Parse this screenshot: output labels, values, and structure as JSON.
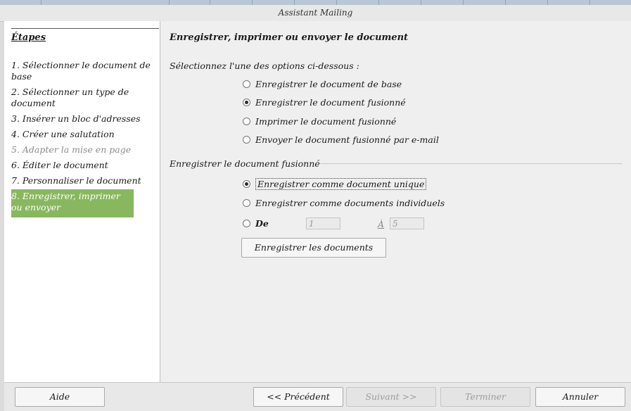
{
  "window": {
    "title": "Assistant Mailing"
  },
  "sidebar": {
    "title": "Étapes",
    "steps": [
      {
        "label": "1. Sélectionner le document de base",
        "state": "normal"
      },
      {
        "label": "2. Sélectionner un type de document",
        "state": "normal"
      },
      {
        "label": "3. Insérer un bloc d'adresses",
        "state": "normal"
      },
      {
        "label": "4. Créer une salutation",
        "state": "normal"
      },
      {
        "label": "5. Adapter la mise en page",
        "state": "disabled"
      },
      {
        "label": "6. Éditer le document",
        "state": "normal"
      },
      {
        "label": "7. Personnaliser le document",
        "state": "normal"
      },
      {
        "label": "8. Enregistrer, imprimer ou envoyer",
        "state": "active"
      }
    ]
  },
  "main": {
    "title": "Enregistrer, imprimer ou envoyer le document",
    "instruction": "Sélectionnez l'une des options ci-dessous :",
    "options": [
      {
        "label": "Enregistrer le document de base",
        "checked": false
      },
      {
        "label": "Enregistrer le document fusionné",
        "checked": true
      },
      {
        "label": "Imprimer le document fusionné",
        "checked": false
      },
      {
        "label": "Envoyer le document fusionné par e-mail",
        "checked": false
      }
    ],
    "section": {
      "label": "Enregistrer le document fusionné",
      "save_options": [
        {
          "label": "Enregistrer comme document unique",
          "checked": true
        },
        {
          "label": "Enregistrer comme documents individuels",
          "checked": false
        }
      ],
      "range": {
        "from_label": "De",
        "from_value": "1",
        "to_label": "À",
        "to_value": "5",
        "checked": false
      },
      "save_button": "Enregistrer les documents"
    }
  },
  "footer": {
    "help": "Aide",
    "previous": "<< Précédent",
    "next": "Suivant >>",
    "finish": "Terminer",
    "cancel": "Annuler"
  },
  "colors": {
    "active_step": "#89b75f"
  }
}
